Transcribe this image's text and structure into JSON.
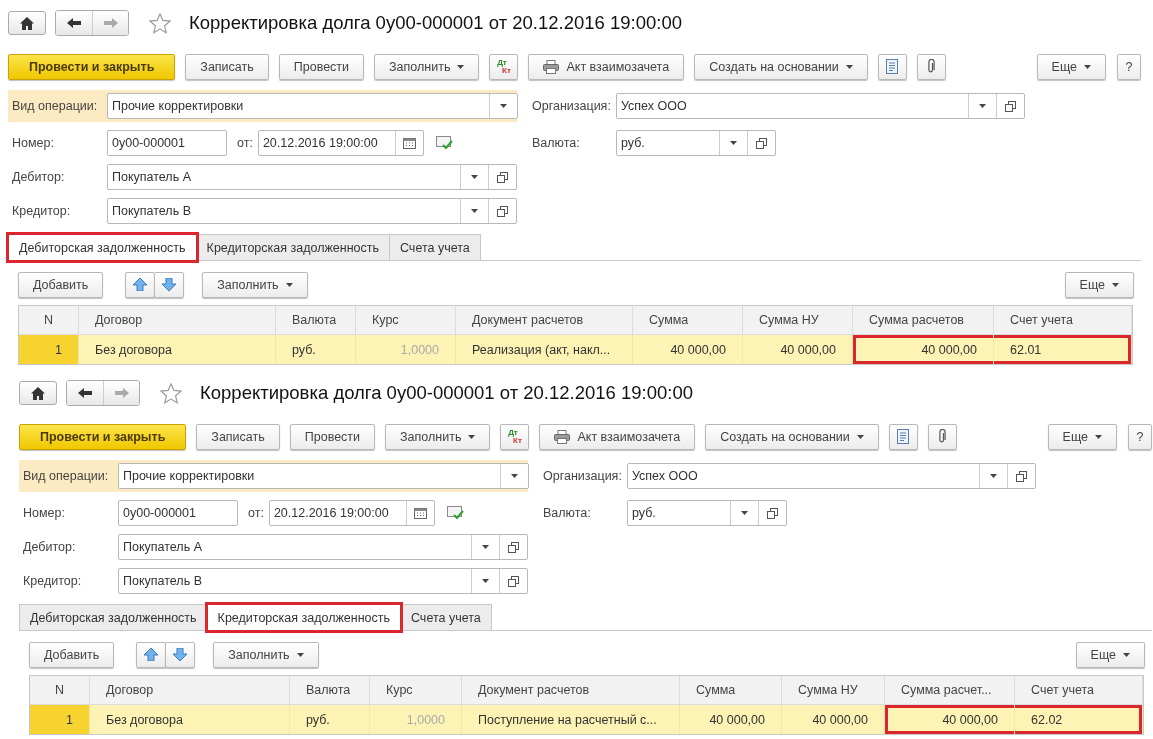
{
  "panels": [
    {
      "title": "Корректировка долга 0у00-000001 от 20.12.2016 19:00:00",
      "toolbar": [
        {
          "kind": "primary",
          "label": "Провести и закрыть"
        },
        {
          "kind": "button",
          "label": "Записать"
        },
        {
          "kind": "button",
          "label": "Провести"
        },
        {
          "kind": "menu",
          "label": "Заполнить"
        },
        {
          "kind": "dtkt",
          "label": "Дт",
          "sub": "Кт"
        },
        {
          "kind": "print",
          "label": "Акт взаимозачета"
        },
        {
          "kind": "menu",
          "label": "Создать на основании"
        },
        {
          "kind": "report"
        },
        {
          "kind": "attach"
        }
      ],
      "toolbar_right": [
        {
          "kind": "menu",
          "label": "Еще"
        },
        {
          "kind": "button",
          "label": "?"
        }
      ],
      "operation": {
        "label": "Вид операции:",
        "value": "Прочие корректировки"
      },
      "organization": {
        "label": "Организация:",
        "value": "Успех ООО"
      },
      "number": {
        "label": "Номер:",
        "value": "0у00-000001"
      },
      "date": {
        "label": "от:",
        "value": "20.12.2016 19:00:00"
      },
      "currency": {
        "label": "Валюта:",
        "value": "руб."
      },
      "debtor": {
        "label": "Дебитор:",
        "value": "Покупатель А"
      },
      "creditor": {
        "label": "Кредитор:",
        "value": "Покупатель В"
      },
      "tabs": [
        {
          "label": "Дебиторская задолженность",
          "selected": true,
          "highlighted": true
        },
        {
          "label": "Кредиторская задолженность",
          "selected": false,
          "highlighted": false
        },
        {
          "label": "Счета учета",
          "selected": false,
          "highlighted": false
        }
      ],
      "table_toolbar": {
        "add": "Добавить",
        "fill": "Заполнить",
        "more": "Еще"
      },
      "table": {
        "columns": [
          "N",
          "Договор",
          "Валюта",
          "Курс",
          "Документ расчетов",
          "Сумма",
          "Сумма НУ",
          "Сумма расчетов",
          "Счет учета"
        ],
        "rows": [
          {
            "selected": true,
            "cells": [
              {
                "text": "1",
                "disabled": false,
                "highlighted": false
              },
              {
                "text": "Без договора",
                "disabled": false,
                "highlighted": false
              },
              {
                "text": "руб.",
                "disabled": false,
                "highlighted": false
              },
              {
                "text": "1,0000",
                "disabled": true,
                "highlighted": false
              },
              {
                "text": "Реализация (акт, накл...",
                "disabled": false,
                "highlighted": false
              },
              {
                "text": "40 000,00",
                "disabled": false,
                "highlighted": false
              },
              {
                "text": "40 000,00",
                "disabled": false,
                "highlighted": false
              },
              {
                "text": "40 000,00",
                "disabled": false,
                "highlighted": true
              },
              {
                "text": "62.01",
                "disabled": false,
                "highlighted": true
              }
            ]
          }
        ]
      }
    },
    {
      "title": "Корректировка долга 0у00-000001 от 20.12.2016 19:00:00",
      "toolbar": [
        {
          "kind": "primary",
          "label": "Провести и закрыть"
        },
        {
          "kind": "button",
          "label": "Записать"
        },
        {
          "kind": "button",
          "label": "Провести"
        },
        {
          "kind": "menu",
          "label": "Заполнить"
        },
        {
          "kind": "dtkt",
          "label": "Дт",
          "sub": "Кт"
        },
        {
          "kind": "print",
          "label": "Акт взаимозачета"
        },
        {
          "kind": "menu",
          "label": "Создать на основании"
        },
        {
          "kind": "report"
        },
        {
          "kind": "attach"
        }
      ],
      "toolbar_right": [
        {
          "kind": "menu",
          "label": "Еще"
        },
        {
          "kind": "button",
          "label": "?"
        }
      ],
      "operation": {
        "label": "Вид операции:",
        "value": "Прочие корректировки"
      },
      "organization": {
        "label": "Организация:",
        "value": "Успех ООО"
      },
      "number": {
        "label": "Номер:",
        "value": "0у00-000001"
      },
      "date": {
        "label": "от:",
        "value": "20.12.2016 19:00:00"
      },
      "currency": {
        "label": "Валюта:",
        "value": "руб."
      },
      "debtor": {
        "label": "Дебитор:",
        "value": "Покупатель А"
      },
      "creditor": {
        "label": "Кредитор:",
        "value": "Покупатель В"
      },
      "tabs": [
        {
          "label": "Дебиторская задолженность",
          "selected": false,
          "highlighted": false
        },
        {
          "label": "Кредиторская задолженность",
          "selected": true,
          "highlighted": true
        },
        {
          "label": "Счета учета",
          "selected": false,
          "highlighted": false
        }
      ],
      "table_toolbar": {
        "add": "Добавить",
        "fill": "Заполнить",
        "more": "Еще"
      },
      "table": {
        "columns": [
          "N",
          "Договор",
          "Валюта",
          "Курс",
          "Документ расчетов",
          "Сумма",
          "Сумма НУ",
          "Сумма расчет...",
          "Счет учета"
        ],
        "rows": [
          {
            "selected": true,
            "cells": [
              {
                "text": "1",
                "disabled": false,
                "highlighted": false
              },
              {
                "text": "Без договора",
                "disabled": false,
                "highlighted": false
              },
              {
                "text": "руб.",
                "disabled": false,
                "highlighted": false
              },
              {
                "text": "1,0000",
                "disabled": true,
                "highlighted": false
              },
              {
                "text": "Поступление на расчетный с...",
                "disabled": false,
                "highlighted": false
              },
              {
                "text": "40 000,00",
                "disabled": false,
                "highlighted": false
              },
              {
                "text": "40 000,00",
                "disabled": false,
                "highlighted": false
              },
              {
                "text": "40 000,00",
                "disabled": false,
                "highlighted": true
              },
              {
                "text": "62.02",
                "disabled": false,
                "highlighted": true
              }
            ]
          }
        ]
      }
    }
  ]
}
